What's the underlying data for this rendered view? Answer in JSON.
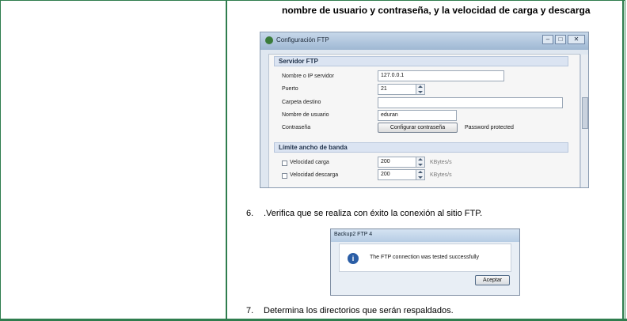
{
  "doc": {
    "line_top": "nombre de usuario y contraseña, y la velocidad de carga y descarga",
    "step6_num": "6.",
    "step6_text": ".Verifica que se  realiza con éxito la conexión al sitio FTP.",
    "step7_num": "7.",
    "step7_text": "Determina los directorios que serán respaldados."
  },
  "ftp_window": {
    "title": "Configuración FTP",
    "controls": {
      "minimize": "–",
      "maximize": "□",
      "close": "✕"
    },
    "section_server": "Servidor FTP",
    "server_label": "Nombre o IP servidor",
    "server_value": "127.0.0.1",
    "port_label": "Puerto",
    "port_value": "21",
    "dest_label": "Carpeta destino",
    "dest_value": "",
    "user_label": "Nombre de usuario",
    "user_value": "eduran",
    "pass_label": "Contraseña",
    "pass_button": "Configurar contraseña",
    "pass_status": "Password protected",
    "section_bw": "Límite ancho de banda",
    "upload_label": "Velocidad carga",
    "upload_value": "200",
    "upload_unit": "KBytes/s",
    "download_label": "Velocidad descarga",
    "download_value": "200",
    "download_unit": "KBytes/s"
  },
  "dialog": {
    "title": "Backup2 FTP 4",
    "message": "The FTP connection was tested successfully",
    "button": "Aceptar",
    "info_glyph": "i"
  }
}
